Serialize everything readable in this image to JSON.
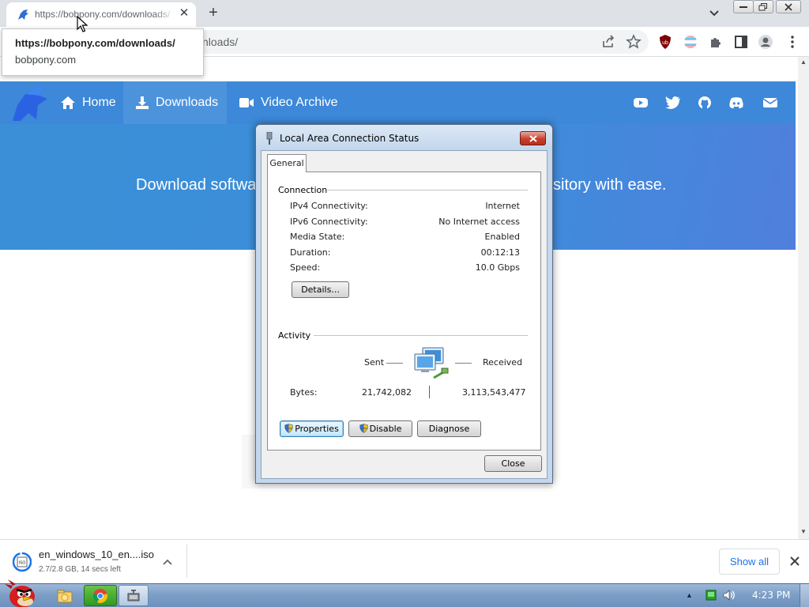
{
  "browser": {
    "tab_title": "https://bobpony.com/downloads/",
    "tab_close": "✕",
    "new_tab": "+",
    "address_visible": "nloads/",
    "hover_card": {
      "url": "https://bobpony.com/downloads/",
      "domain": "bobpony.com"
    }
  },
  "site": {
    "nav": [
      {
        "label": "Home",
        "icon": "home-icon"
      },
      {
        "label": "Downloads",
        "icon": "download-icon"
      },
      {
        "label": "Video Archive",
        "icon": "video-camera-icon"
      }
    ],
    "social_icons": [
      "youtube-icon",
      "twitter-icon",
      "github-icon",
      "discord-icon",
      "mail-icon"
    ],
    "hero_left": "Download softwa",
    "hero_right": "sitory with ease."
  },
  "dialog": {
    "title": "Local Area Connection Status",
    "tab": "General",
    "connection_header": "Connection",
    "rows": [
      {
        "label": "IPv4 Connectivity:",
        "value": "Internet"
      },
      {
        "label": "IPv6 Connectivity:",
        "value": "No Internet access"
      },
      {
        "label": "Media State:",
        "value": "Enabled"
      },
      {
        "label": "Duration:",
        "value": "00:12:13"
      },
      {
        "label": "Speed:",
        "value": "10.0 Gbps"
      }
    ],
    "details_button": "Details...",
    "activity_header": "Activity",
    "sent_label": "Sent",
    "received_label": "Received",
    "bytes_label": "Bytes:",
    "bytes_sent": "21,742,082",
    "bytes_received": "3,113,543,477",
    "properties_button": "Properties",
    "disable_button": "Disable",
    "diagnose_button": "Diagnose",
    "close_button": "Close"
  },
  "download": {
    "filename": "en_windows_10_en....iso",
    "status": "2.7/2.8 GB, 14 secs left",
    "show_all": "Show all",
    "progress": 0.96
  },
  "taskbar": {
    "clock": "4:23 PM"
  },
  "colors": {
    "site_nav": "#3d88d8",
    "hero": "#3a8fd6",
    "dialog_frame": "#c4d7ec",
    "taskbar": "#7d9fc7",
    "link_blue": "#1a73e8"
  }
}
